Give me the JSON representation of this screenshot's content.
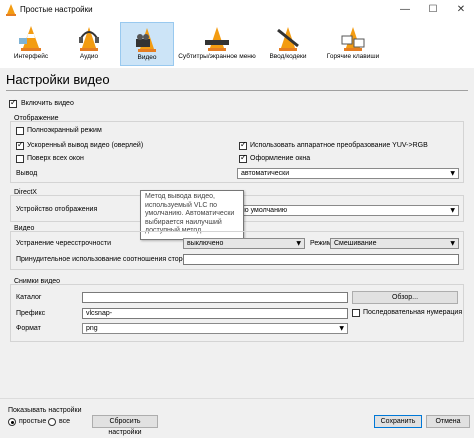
{
  "window": {
    "title": "Простые настройки",
    "minimize": "—",
    "maximize": "☐",
    "close": "✕"
  },
  "toolbar": [
    {
      "label": "Интерфейс"
    },
    {
      "label": "Аудио"
    },
    {
      "label": "Видео"
    },
    {
      "label": "Субтитры/экранное меню"
    },
    {
      "label": "Ввод/кодеки"
    },
    {
      "label": "Горячие клавиши"
    }
  ],
  "page_title": "Настройки видео",
  "enable_video": {
    "label": "Включить видео",
    "checked": true
  },
  "display": {
    "title": "Отображение",
    "fullscreen": "Полноэкранный режим",
    "accelerated": "Ускоренный вывод видео (оверлей)",
    "on_top": "Поверх всех окон",
    "yuv": "Использовать аппаратное преобразование YUV->RGB",
    "decorations": "Оформление окна",
    "output_label": "Вывод",
    "output_value": "автоматически"
  },
  "directx": {
    "title": "DirectX",
    "device_label": "Устройство отображения",
    "device_value": "по умолчанию"
  },
  "tooltip": [
    "Метод вывода видео,",
    "используемый VLC по",
    "умолчанию. Автоматически",
    "выбирается наилучший",
    "доступный метод."
  ],
  "video": {
    "title": "Видео",
    "deinterlace_label": "Устранение чересстрочности",
    "deinterlace_value": "выключено",
    "mode_label": "Режим",
    "mode_value": "Смешивание",
    "aspect_label": "Принудительное использование соотношения сторон",
    "aspect_value": ""
  },
  "snapshots": {
    "title": "Снимки видео",
    "dir_label": "Каталог",
    "dir_value": "",
    "browse": "Обзор...",
    "prefix_label": "Префикс",
    "prefix_value": "vlcsnap-",
    "sequential": "Последовательная нумерация",
    "format_label": "Формат",
    "format_value": "png"
  },
  "footer": {
    "show_label": "Показывать настройки",
    "simple": "простые",
    "all": "все",
    "reset": "Сбросить настройки",
    "save": "Сохранить",
    "cancel": "Отмена"
  }
}
